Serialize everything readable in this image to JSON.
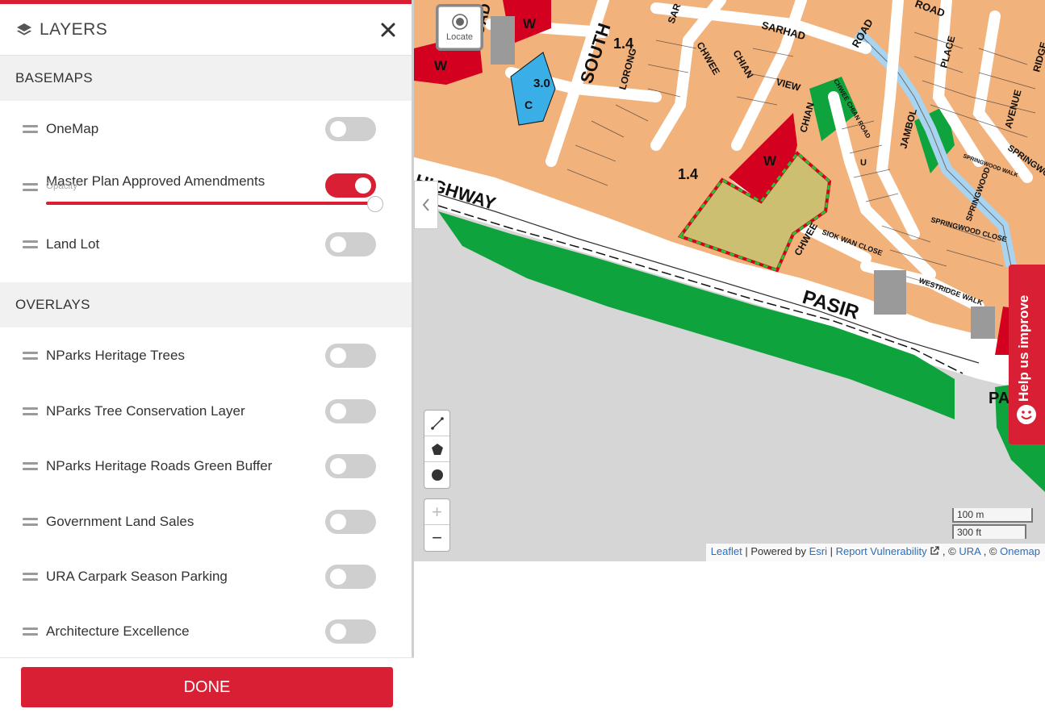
{
  "panel": {
    "title": "LAYERS",
    "icons": {
      "header": "layers-icon",
      "close": "close-icon",
      "drag": "drag-handle-icon"
    },
    "basemaps_title": "BASEMAPS",
    "basemaps": [
      {
        "label": "OneMap",
        "on": false
      },
      {
        "label": "Master Plan Approved Amendments",
        "on": true,
        "opacity_label": "Opacity",
        "opacity": 1.0
      },
      {
        "label": "Land Lot",
        "on": false
      }
    ],
    "overlays_title": "OVERLAYS",
    "overlays": [
      {
        "label": "NParks Heritage Trees",
        "on": false
      },
      {
        "label": "NParks Tree Conservation Layer",
        "on": false
      },
      {
        "label": "NParks Heritage Roads Green Buffer",
        "on": false
      },
      {
        "label": "Government Land Sales",
        "on": false
      },
      {
        "label": "URA Carpark Season Parking",
        "on": false
      },
      {
        "label": "Architecture Excellence",
        "on": false
      }
    ],
    "done_label": "DONE"
  },
  "map": {
    "locate_label": "Locate",
    "zoom_in": "+",
    "zoom_out": "−",
    "scale": {
      "metric": "100 m",
      "imperial": "300 ft"
    },
    "attribution": {
      "leaflet": "Leaflet",
      "powered_by": "| Powered by",
      "esri": "Esri",
      "sep1": "|",
      "report": "Report Vulnerability",
      "sep2": ", ©",
      "ura": "URA",
      "sep3": ", ©",
      "onemap": "Onemap"
    },
    "help_label": "Help us improve",
    "labels": {
      "highway": "HIGHWAY",
      "pasir": "PASIR",
      "south": "SOUTH",
      "road_ne": "ROAD",
      "road_top": "ROAD",
      "sarhad": "SARHAD",
      "chwee1": "CHWEE",
      "chian1": "CHIAN",
      "view": "VIEW",
      "chian2": "CHIAN",
      "chwee2": "CHWEE",
      "lorong": "LORONG",
      "jambol": "JAMBOL",
      "place": "PLACE",
      "avenue": "AVENUE",
      "springwood": "SPRINGWOOD",
      "springwood_close": "SPRINGWOOD CLOSE",
      "westridge_walk": "WESTRIDGE WALK",
      "siok_wan_close": "SIOK WAN CLOSE",
      "chwee_chian_road": "CHWEE CHIAN ROAD",
      "springwood_walk": "SPRINGWOOD WALK",
      "springwood_right": "SPRINGWO",
      "ridge": "RIDGE",
      "pa": "PA",
      "oad": "OAD",
      "sar": "SAR",
      "lu": "LU",
      "plot_ratio_1": "1.4",
      "plot_ratio_2": "1.4",
      "plot_ratio_3": "3.0",
      "zone_w1": "W",
      "zone_w2": "W",
      "zone_w3": "W",
      "zone_c": "C",
      "zone_u": "U"
    },
    "colors": {
      "residential": "#f2b27c",
      "waterbody": "#a8d4f0",
      "park": "#0fa33d",
      "utility": "#d4001f",
      "civic": "#3aaee6",
      "road": "#ffffff",
      "sea_grey": "#d6d6d6",
      "selection_fill": "#cdbf72",
      "accent": "#d81f34"
    }
  }
}
